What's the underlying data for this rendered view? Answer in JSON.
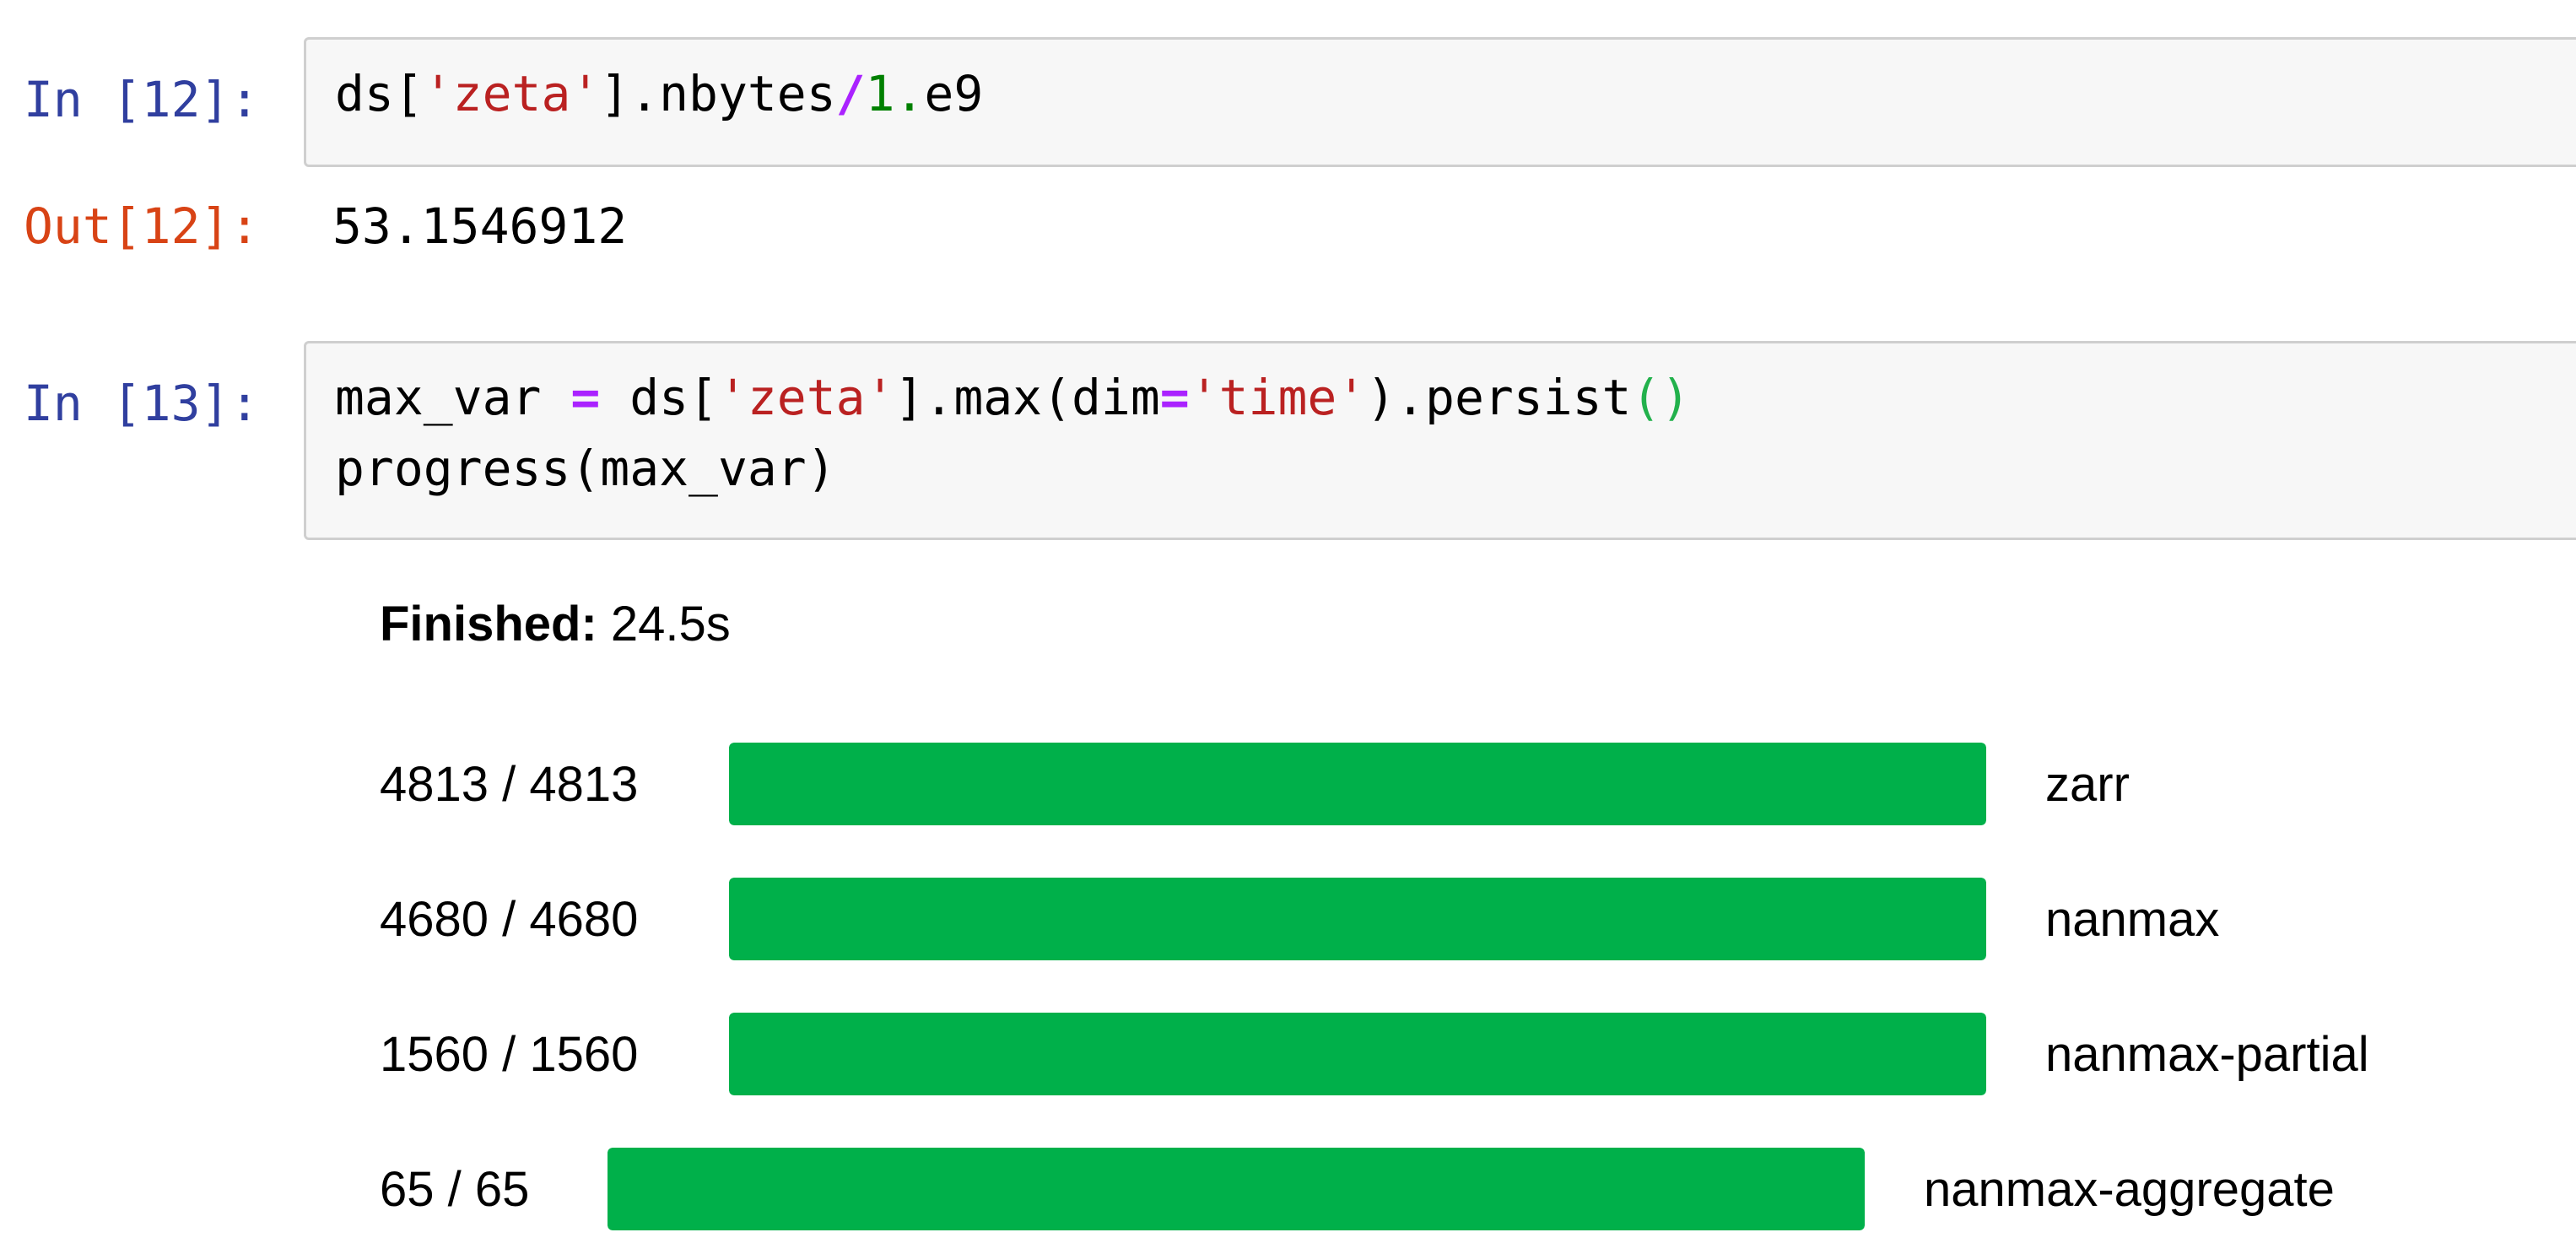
{
  "cells": {
    "in12": {
      "prompt": "In [12]:",
      "code": {
        "t1": "ds[",
        "t2": "'zeta'",
        "t3": "].nbytes",
        "t4": "/",
        "t5": "1.",
        "t6": "e9"
      }
    },
    "out12": {
      "prompt": "Out[12]:",
      "value": "53.1546912"
    },
    "in13": {
      "prompt": "In [13]:",
      "line1": {
        "t1": "max_var ",
        "t2": "=",
        "t3": " ds[",
        "t4": "'zeta'",
        "t5": "].max(dim",
        "t6": "=",
        "t7": "'time'",
        "t8": ").persist",
        "t9": "()"
      },
      "line2": "progress(max_var)"
    }
  },
  "progress": {
    "finished_label": "Finished:",
    "finished_time": "24.5s",
    "rows": [
      {
        "count": "4813 / 4813",
        "name": "zarr",
        "fraction": 1.0
      },
      {
        "count": "4680 / 4680",
        "name": "nanmax",
        "fraction": 1.0
      },
      {
        "count": "1560 / 1560",
        "name": "nanmax-partial",
        "fraction": 1.0
      },
      {
        "count": "65 / 65",
        "name": "nanmax-aggregate",
        "fraction": 1.0
      }
    ],
    "bar_color": "#00b04a"
  },
  "colors": {
    "in_prompt": "#303f9f",
    "out_prompt": "#d84315",
    "string": "#ba2121",
    "operator": "#aa22ff",
    "number": "#008000"
  }
}
